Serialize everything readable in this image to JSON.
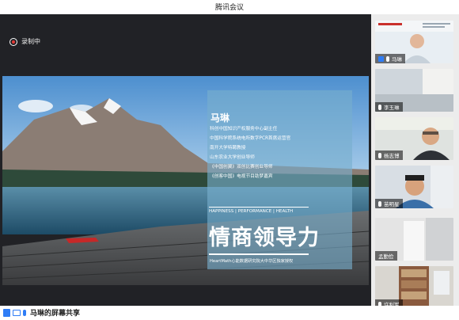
{
  "app": {
    "title": "腾讯会议"
  },
  "recording": {
    "label": "录制中",
    "icon": "record-icon"
  },
  "slide": {
    "speaker_name": "马琳",
    "bio_lines": [
      "科创中国知识产权服务中心副主任",
      "中国科学院系统电所数字PCR首席运营官",
      "南开大学特聘教授",
      "山东农业大学创业导师",
      "《中国创翼》双创比赛创业导师",
      "《创客中国》电视节目助梦嘉宾"
    ],
    "tagline": "HAPPINESS | PERFORMANCE | HEALTH",
    "course_title": "情商领导力",
    "footer_text": "HeartMath心能数据研究院大中华区独家授权",
    "accent_color": "#78afcd"
  },
  "participants": [
    {
      "name": "马琳",
      "icons": [
        "person-icon",
        "mic-icon"
      ]
    },
    {
      "name": "李玉琳",
      "icons": [
        "mic-icon"
      ]
    },
    {
      "name": "杨志博",
      "icons": [
        "mic-icon"
      ]
    },
    {
      "name": "苗明星",
      "icons": [
        "mic-icon"
      ]
    },
    {
      "name": "孟勤俭",
      "icons": []
    },
    {
      "name": "许利军",
      "icons": [
        "mic-icon"
      ]
    }
  ],
  "share_status": {
    "label": "马琳的屏幕共享",
    "icons": [
      "share-icon",
      "screen-icon",
      "mic-icon"
    ]
  }
}
